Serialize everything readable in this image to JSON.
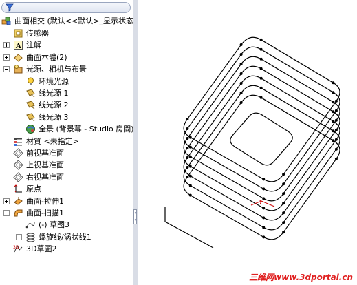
{
  "tree": {
    "root_label": "曲面相交  (默认<<默认>_显示状态",
    "items": [
      {
        "label": "传感器",
        "icon": "sensor-icon",
        "expander": "none"
      },
      {
        "label": "注解",
        "icon": "annotation-icon",
        "expander": "plus"
      },
      {
        "label": "曲面本體(2)",
        "icon": "surface-body-icon",
        "expander": "plus"
      },
      {
        "label": "光源、相机与布景",
        "icon": "lights-cameras-icon",
        "expander": "minus"
      },
      {
        "label": "环境光源",
        "icon": "ambient-light-icon",
        "expander": "none"
      },
      {
        "label": "线光源 1",
        "icon": "directional-light-icon",
        "expander": "none"
      },
      {
        "label": "线光源 2",
        "icon": "directional-light-icon",
        "expander": "none"
      },
      {
        "label": "线光源 3",
        "icon": "directional-light-icon",
        "expander": "none"
      },
      {
        "label": "全景 (背景幕 - Studio 房間)",
        "icon": "scene-icon",
        "expander": "none"
      },
      {
        "label": "材質 <未指定>",
        "icon": "material-icon",
        "expander": "none"
      },
      {
        "label": "前视基准面",
        "icon": "plane-icon",
        "expander": "none"
      },
      {
        "label": "上视基准面",
        "icon": "plane-icon",
        "expander": "none"
      },
      {
        "label": "右视基准面",
        "icon": "plane-icon",
        "expander": "none"
      },
      {
        "label": "原点",
        "icon": "origin-icon",
        "expander": "none"
      },
      {
        "label": "曲面-拉伸1",
        "icon": "surface-extrude-icon",
        "expander": "plus"
      },
      {
        "label": "曲面-扫描1",
        "icon": "surface-sweep-icon",
        "expander": "minus"
      },
      {
        "label": "(-) 草图3",
        "icon": "sketch-icon",
        "expander": "none"
      },
      {
        "label": "螺旋线/涡状线1",
        "icon": "helix-icon",
        "expander": "plus"
      },
      {
        "label": "3D草圖2",
        "icon": "3d-sketch-icon",
        "expander": "none"
      }
    ]
  },
  "watermark": {
    "cn": "三维网",
    "en": "www.3dportal.cn"
  },
  "colors": {
    "accent_red": "#e02020",
    "selection_blue": "#316ac5"
  }
}
